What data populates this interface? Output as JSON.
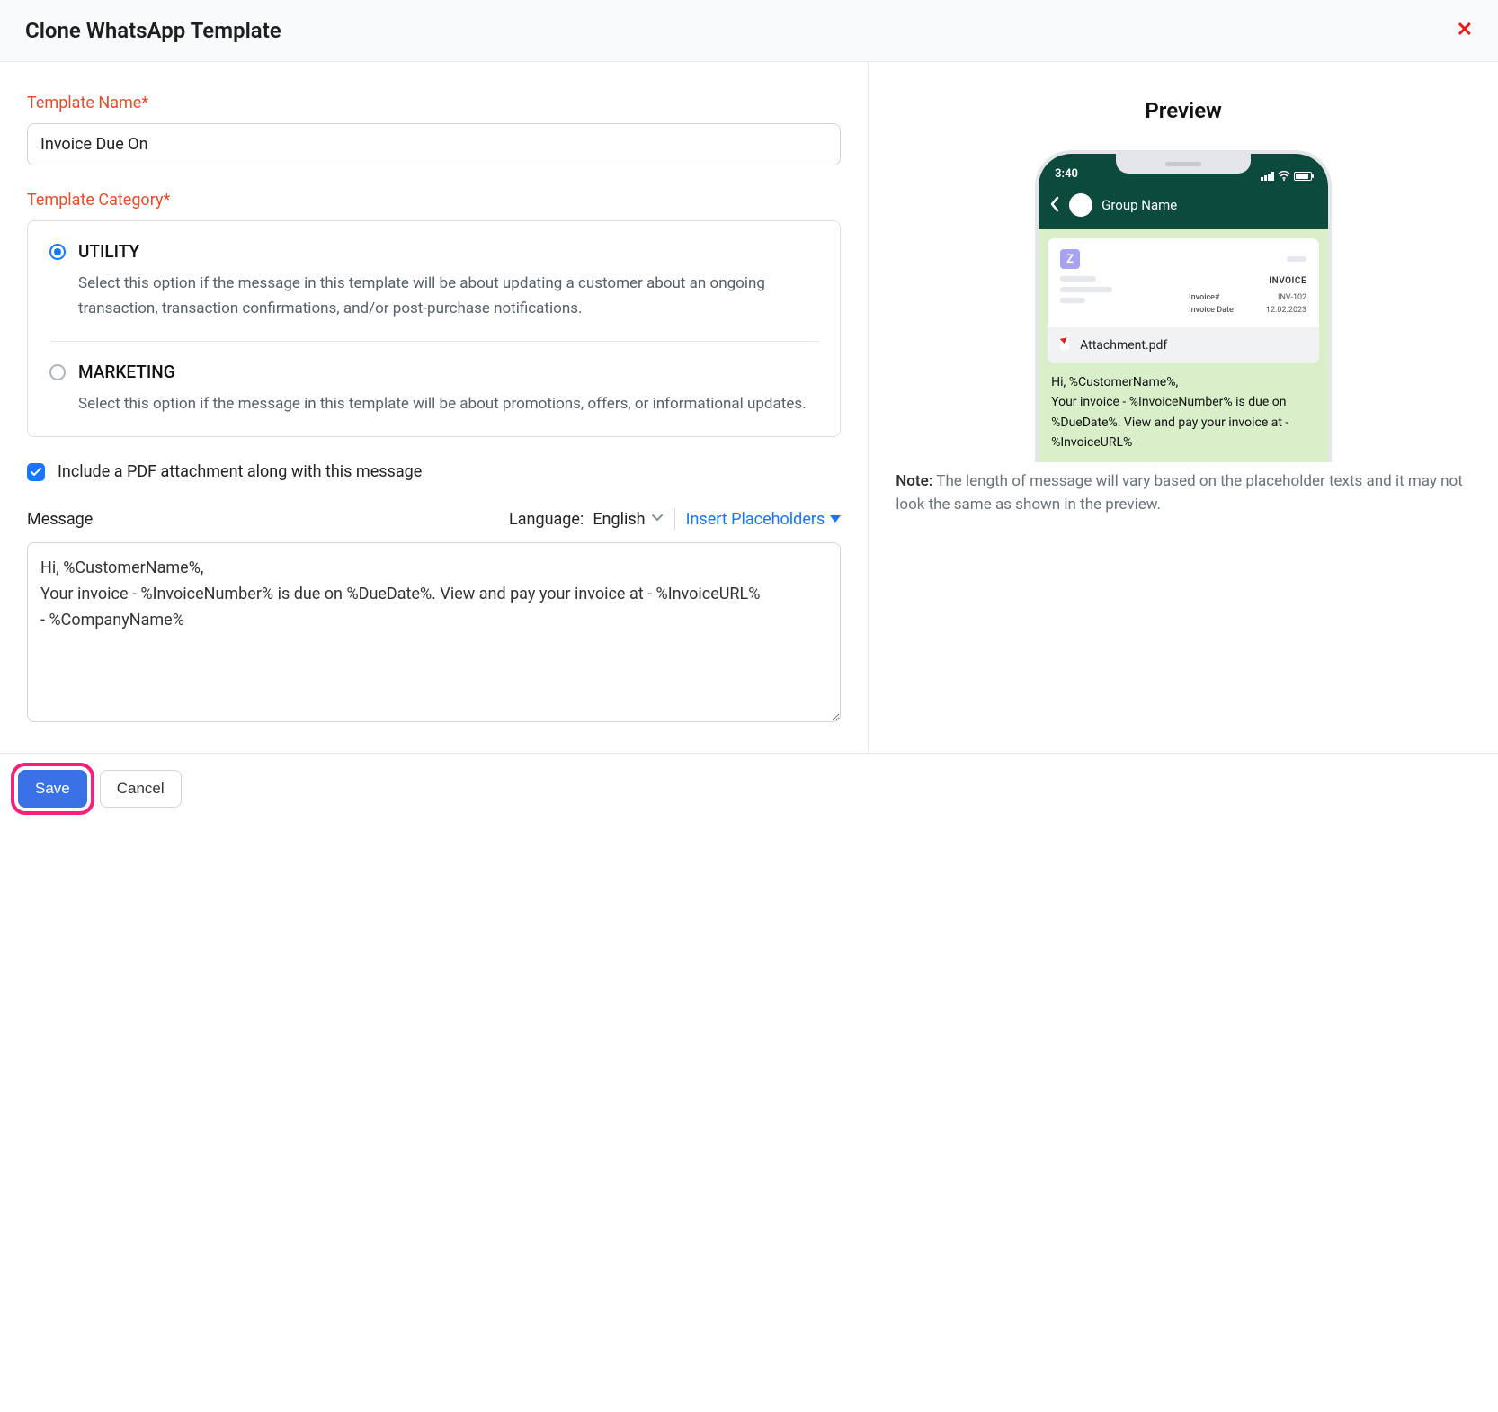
{
  "header": {
    "title": "Clone WhatsApp Template"
  },
  "form": {
    "name_label": "Template Name*",
    "name_value": "Invoice Due On",
    "category_label": "Template Category*",
    "categories": {
      "utility": {
        "title": "UTILITY",
        "desc": "Select this option if the message in this template will be about updating a customer about an ongoing transaction, transaction confirmations, and/or post-purchase notifications."
      },
      "marketing": {
        "title": "MARKETING",
        "desc": "Select this option if the message in this template will be about promotions, offers, or informational updates."
      }
    },
    "include_pdf_label": "Include a PDF attachment along with this message",
    "message_label": "Message",
    "language_label": "Language:",
    "language_value": "English",
    "insert_placeholders": "Insert Placeholders",
    "message_value": "Hi, %CustomerName%,\nYour invoice - %InvoiceNumber% is due on %DueDate%. View and pay your invoice at - %InvoiceURL%\n- %CompanyName%"
  },
  "preview": {
    "title": "Preview",
    "phone_time": "3:40",
    "chat_name": "Group Name",
    "doc": {
      "badge": "Z",
      "title": "INVOICE",
      "rows": [
        {
          "label": "Invoice#",
          "value": "INV-102"
        },
        {
          "label": "Invoice Date",
          "value": "12.02.2023"
        }
      ]
    },
    "attachment_name": "Attachment.pdf",
    "message_text": "Hi, %CustomerName%,\nYour invoice - %InvoiceNumber% is due on %DueDate%. View and pay your invoice at - %InvoiceURL%",
    "note_label": "Note:",
    "note_text": "The length of message will vary based on the placeholder texts and it may not look the same as shown in the preview."
  },
  "footer": {
    "save": "Save",
    "cancel": "Cancel"
  }
}
